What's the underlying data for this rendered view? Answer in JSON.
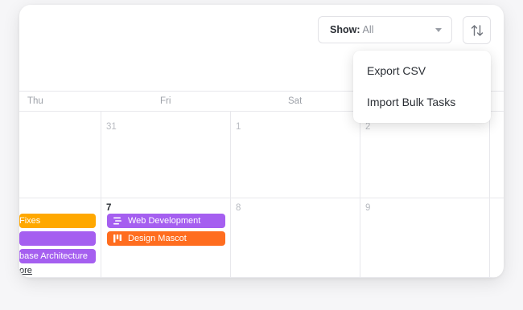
{
  "filter": {
    "label": "Show:",
    "value": "All"
  },
  "sort": {
    "icon": "sort-arrows-icon"
  },
  "menu": {
    "items": [
      {
        "label": "Export CSV"
      },
      {
        "label": "Import Bulk Tasks"
      }
    ]
  },
  "weekdays": [
    "Thu",
    "Fri",
    "Sat"
  ],
  "week1": {
    "dates": [
      "31",
      "1",
      "2"
    ]
  },
  "week2": {
    "dates": [
      "7",
      "8",
      "9"
    ],
    "thu_tasks": [
      {
        "title": "Fixes",
        "color": "#ffa800"
      },
      {
        "title": "",
        "color": "#a55ff0"
      },
      {
        "title": "base Architecture",
        "color": "#a55ff0"
      }
    ],
    "fri_tasks": [
      {
        "title": "Web Development",
        "color": "#a55ff0",
        "icon": "list-icon"
      },
      {
        "title": "Design Mascot",
        "color": "#ff6d1f",
        "icon": "board-icon"
      }
    ],
    "more_label": "ore"
  }
}
